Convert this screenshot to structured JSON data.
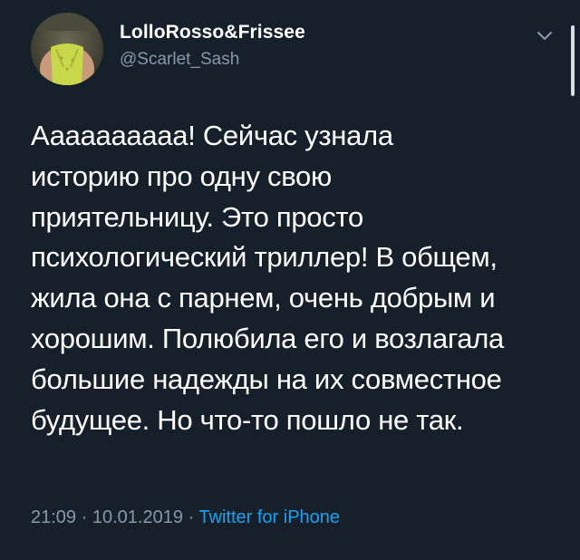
{
  "tweet": {
    "display_name": "LolloRosso&Frissee",
    "handle": "@Scarlet_Sash",
    "text_lines": [
      "Аааааааааа! Сейчас узнала",
      "историю про одну свою",
      "приятельницу. Это просто",
      "психологический триллер! В общем,",
      "жила она с парнем, очень добрым и",
      "хорошим. Полюбила его и возлагала",
      "большие надежды на их совместное",
      "будущее. Но что-то пошло не так."
    ],
    "time": "21:09",
    "separator": "·",
    "date": "10.01.2019",
    "source": "Twitter for iPhone"
  },
  "icons": {
    "menu": "chevron-down-icon",
    "avatar": "avatar-photo"
  },
  "colors": {
    "background": "#15202b",
    "primary_text": "#ffffff",
    "secondary_text": "#8899a6",
    "link": "#1da1f2"
  }
}
